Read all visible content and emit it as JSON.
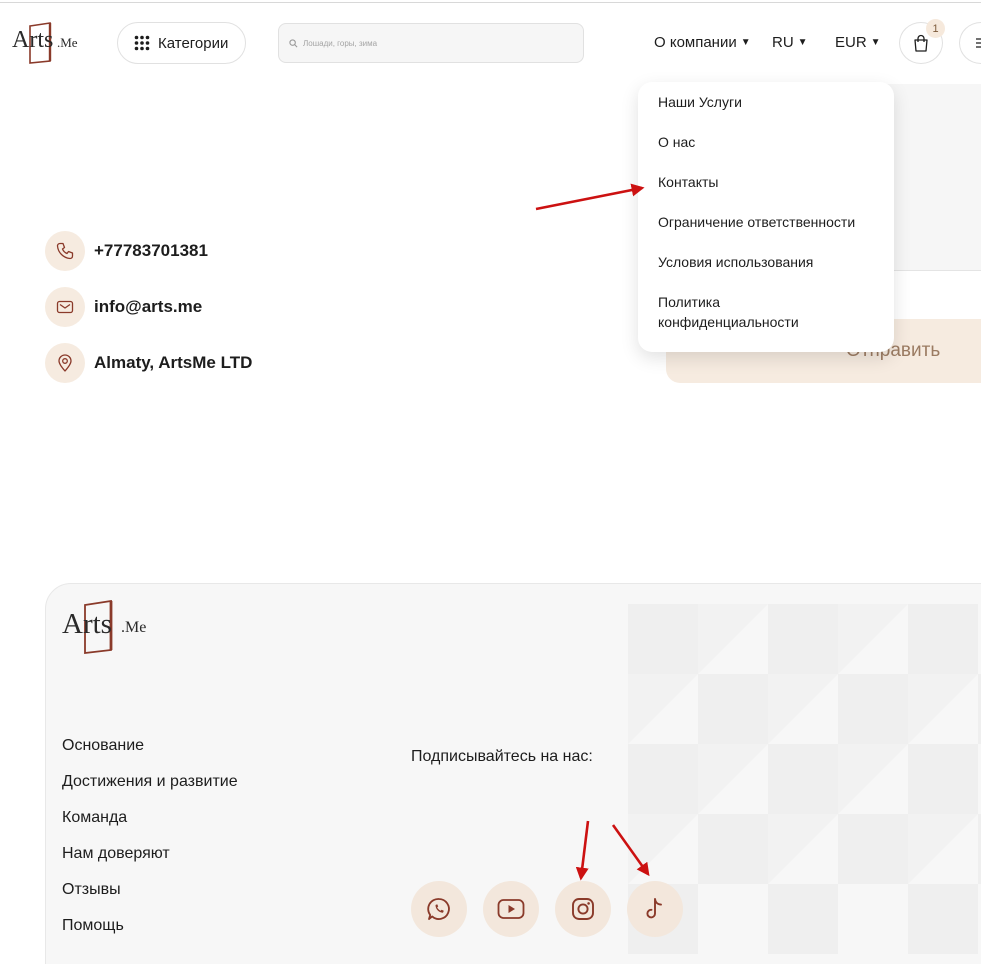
{
  "header": {
    "logo": {
      "word": "Arts",
      "suffix": ".Me"
    },
    "categories_label": "Категории",
    "search_placeholder": "Лошади, горы, зима",
    "nav": {
      "company_label": "О компании",
      "language_label": "RU",
      "currency_label": "EUR"
    },
    "cart_count": "1"
  },
  "dropdown": {
    "items": [
      "Наши Услуги",
      "О нас",
      "Контакты",
      "Ограничение ответственности",
      "Условия использования",
      "Политика конфиденциальности"
    ]
  },
  "form": {
    "send_label": "Отправить"
  },
  "contacts": {
    "phone": "+77783701381",
    "email": "info@arts.me",
    "address": "Almaty, ArtsMe LTD"
  },
  "footer": {
    "logo": {
      "word": "Arts",
      "suffix": ".Me"
    },
    "links": [
      "Основание",
      "Достижения и развитие",
      "Команда",
      "Нам доверяют",
      "Отзывы",
      "Помощь"
    ],
    "subscribe_label": "Подписывайтесь на нас:",
    "socials": [
      "whatsapp-icon",
      "youtube-icon",
      "instagram-icon",
      "tiktok-icon"
    ]
  },
  "colors": {
    "accent": "#8a3a2a",
    "icon_bg": "#f6ebe0",
    "annotation_arrow": "#cc1111"
  }
}
